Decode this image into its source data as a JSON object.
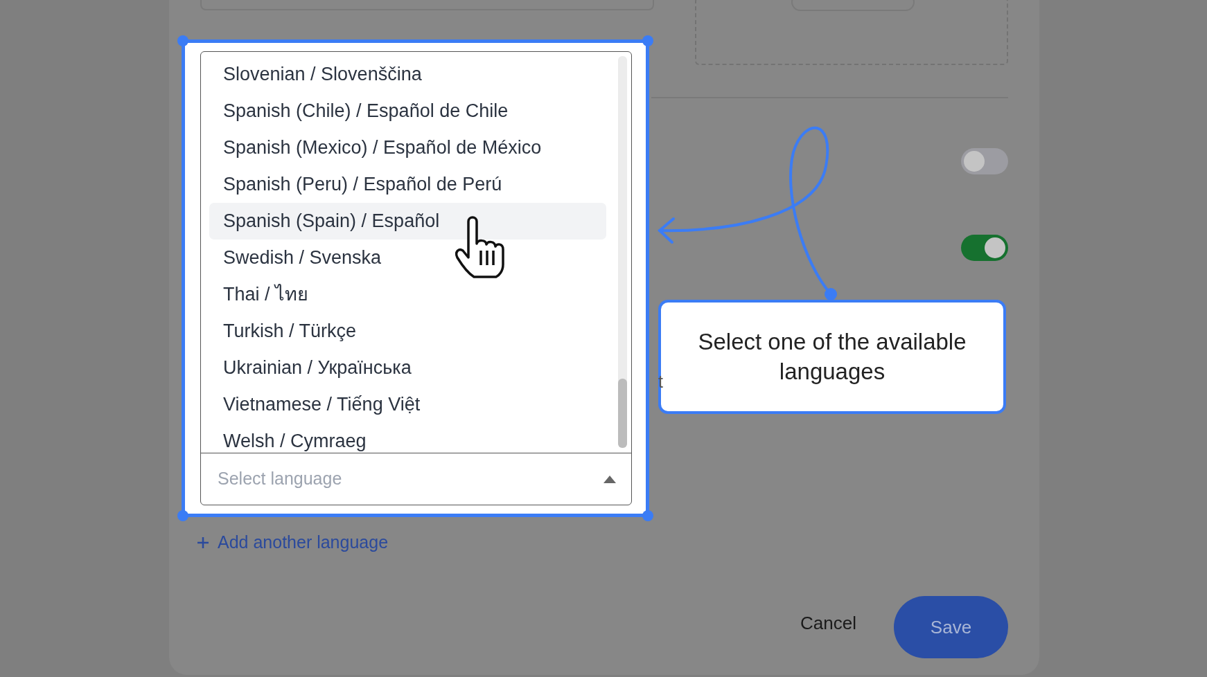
{
  "dropdown": {
    "options": [
      {
        "label": "Slovenian / Slovenščina",
        "highlighted": false
      },
      {
        "label": "Spanish (Chile) / Español de Chile",
        "highlighted": false
      },
      {
        "label": "Spanish (Mexico) / Español de México",
        "highlighted": false
      },
      {
        "label": "Spanish (Peru) / Español de Perú",
        "highlighted": false
      },
      {
        "label": "Spanish (Spain) / Español",
        "highlighted": true
      },
      {
        "label": "Swedish / Svenska",
        "highlighted": false
      },
      {
        "label": "Thai / ไทย",
        "highlighted": false
      },
      {
        "label": "Turkish / Türkçe",
        "highlighted": false
      },
      {
        "label": "Ukrainian / Українська",
        "highlighted": false
      },
      {
        "label": "Vietnamese / Tiếng Việt",
        "highlighted": false
      },
      {
        "label": "Welsh / Cymraeg",
        "highlighted": false
      }
    ],
    "placeholder": "Select language"
  },
  "add_link": {
    "label": "Add another language"
  },
  "settings": {
    "toggles": [
      {
        "on": false
      },
      {
        "on": true
      }
    ],
    "partial_text": "t"
  },
  "tooltip": {
    "text": "Select one of the available languages"
  },
  "buttons": [
    {
      "label": "Cancel",
      "kind": "text"
    },
    {
      "label": "Save",
      "kind": "primary"
    }
  ]
}
